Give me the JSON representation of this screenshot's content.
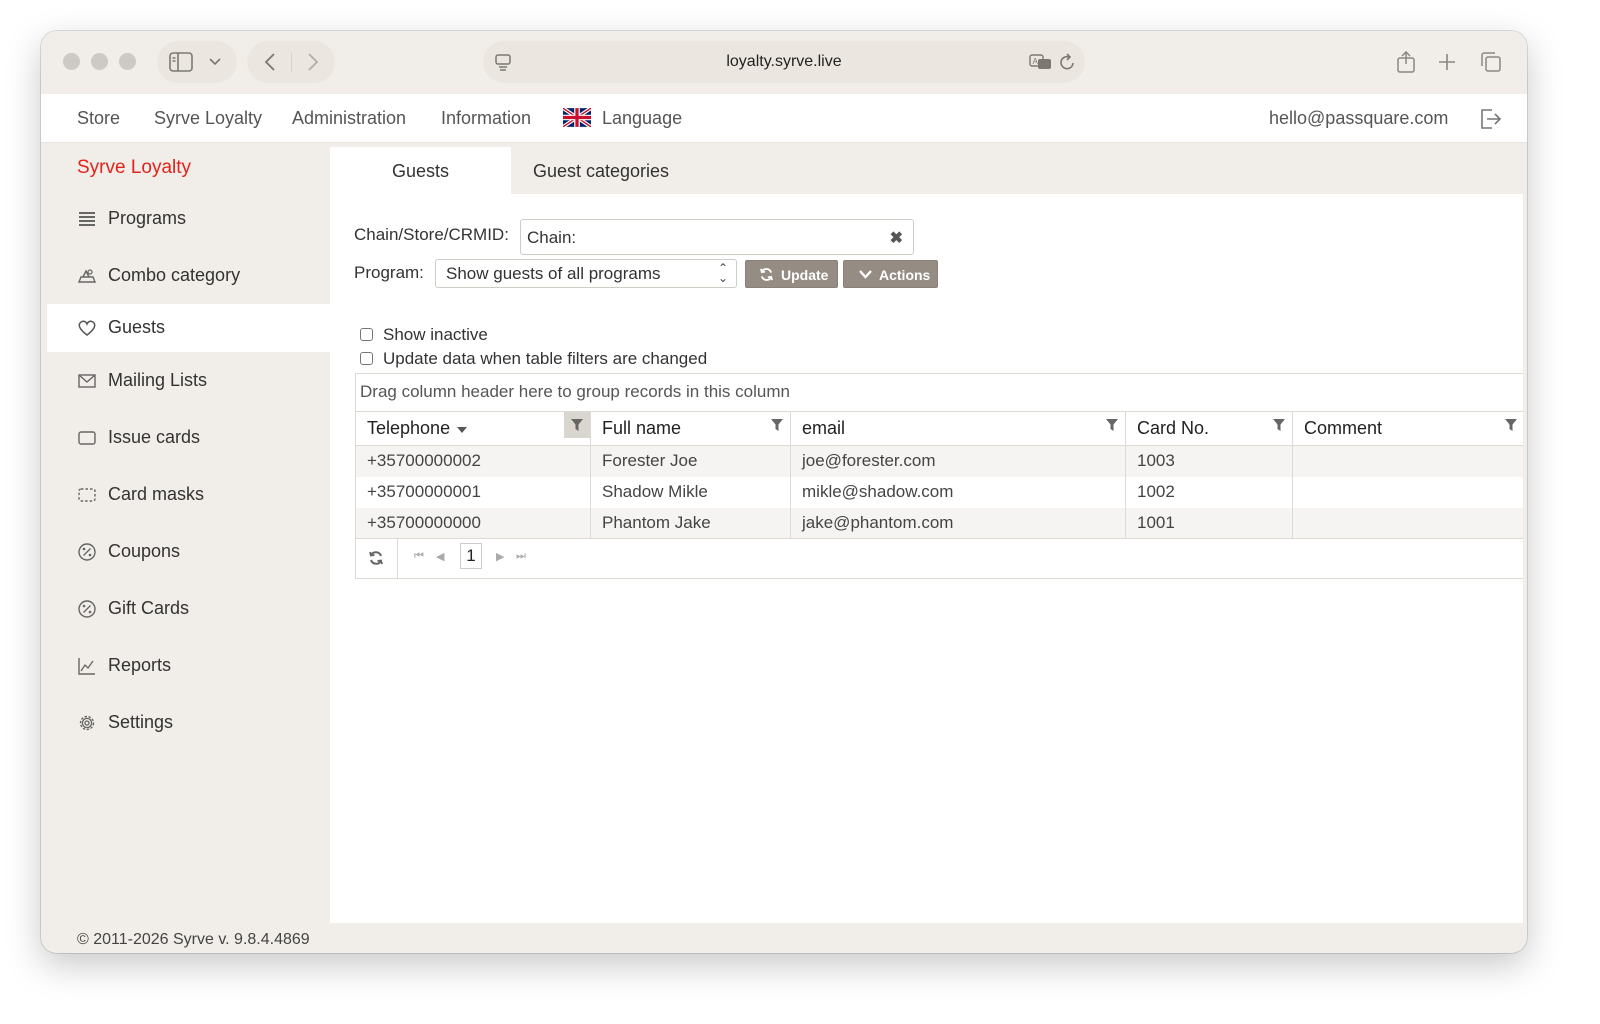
{
  "browser": {
    "url": "loyalty.syrve.live"
  },
  "topnav": {
    "items": [
      "Store",
      "Syrve Loyalty",
      "Administration",
      "Information"
    ],
    "language_label": "Language",
    "user_email": "hello@passquare.com"
  },
  "sidebar": {
    "brand": "Syrve Loyalty",
    "items": [
      {
        "label": "Programs",
        "icon": "list-icon"
      },
      {
        "label": "Combo category",
        "icon": "combo-icon"
      },
      {
        "label": "Guests",
        "icon": "heart-icon"
      },
      {
        "label": "Mailing Lists",
        "icon": "envelope-icon"
      },
      {
        "label": "Issue cards",
        "icon": "card-icon"
      },
      {
        "label": "Card masks",
        "icon": "card-mask-icon"
      },
      {
        "label": "Coupons",
        "icon": "percent-icon"
      },
      {
        "label": "Gift Cards",
        "icon": "percent-icon"
      },
      {
        "label": "Reports",
        "icon": "chart-icon"
      },
      {
        "label": "Settings",
        "icon": "gear-icon"
      }
    ],
    "active_item": "Guests",
    "footer": "© 2011-2026 Syrve v. 9.8.4.4869"
  },
  "tabs": [
    "Guests",
    "Guest categories"
  ],
  "filters": {
    "chain_label": "Chain/Store/CRMID:",
    "chain_value": "Chain:",
    "program_label": "Program:",
    "program_value": "Show guests of all programs",
    "update_button": "Update",
    "actions_button": "Actions",
    "show_inactive": "Show inactive",
    "update_on_filter": "Update data when table filters are changed"
  },
  "grid": {
    "group_hint": "Drag column header here to group records in this column",
    "columns": [
      "Telephone",
      "Full name",
      "email",
      "Card No.",
      "Comment"
    ],
    "rows": [
      {
        "telephone": "+35700000002",
        "name": "Forester Joe",
        "email": "joe@forester.com",
        "card": "1003",
        "comment": ""
      },
      {
        "telephone": "+35700000001",
        "name": "Shadow Mikle",
        "email": "mikle@shadow.com",
        "card": "1002",
        "comment": ""
      },
      {
        "telephone": "+35700000000",
        "name": "Phantom Jake",
        "email": "jake@phantom.com",
        "card": "1001",
        "comment": ""
      }
    ],
    "current_page": "1"
  }
}
